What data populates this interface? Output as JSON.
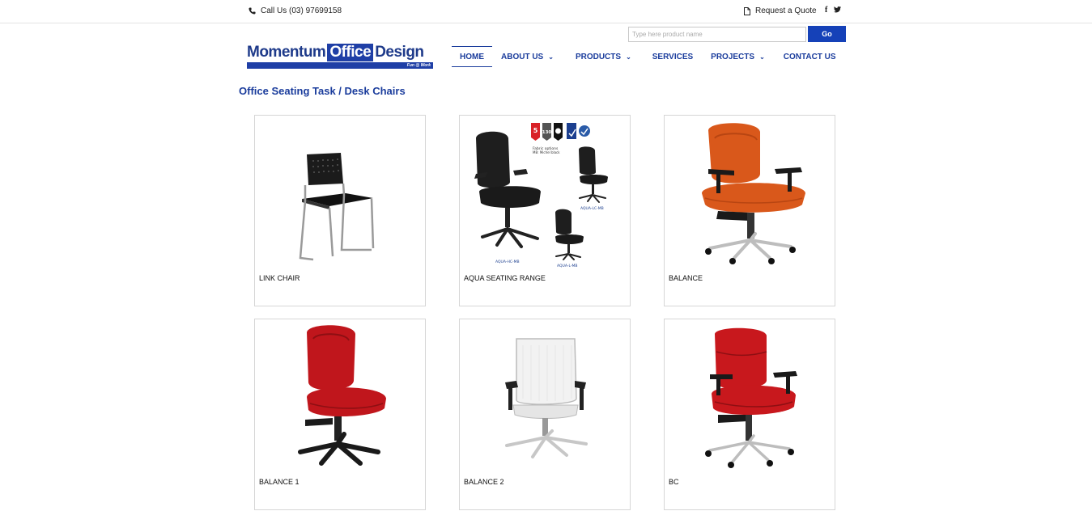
{
  "topbar": {
    "phone": "Call Us (03) 97699158",
    "quote": "Request a Quote",
    "social": [
      "f",
      "t"
    ]
  },
  "search": {
    "placeholder": "Type here product name",
    "button": "Go"
  },
  "logo": {
    "momentum": "Momentum",
    "office": "Office",
    "design": "Design",
    "tagline": "Fun @ Work"
  },
  "nav": {
    "items": [
      {
        "label": "HOME"
      },
      {
        "label": "ABOUT US"
      },
      {
        "label": "PRODUCTS"
      },
      {
        "label": "SERVICES"
      },
      {
        "label": "PROJECTS"
      },
      {
        "label": "CONTACT US"
      }
    ]
  },
  "page": {
    "title": "Office Seating Task / Desk Chairs"
  },
  "products": [
    {
      "name": "LINK CHAIR",
      "color": "#1b1b1b"
    },
    {
      "name": "AQUA SEATING RANGE",
      "color": "#1b1b1b"
    },
    {
      "name": "BALANCE",
      "color": "#d9581b"
    },
    {
      "name": "BALANCE 1",
      "color": "#c0161c"
    },
    {
      "name": "BALANCE 2",
      "color": "#f2f2f2"
    },
    {
      "name": "BC",
      "color": "#c8181d"
    }
  ],
  "aqua": {
    "badges": [
      "5",
      "130",
      "",
      "",
      ""
    ],
    "caption_top": "Fabric options",
    "caption_sub": "MB: Michel black",
    "models": [
      "AQUA-HC-MB",
      "AQUA-LC-MB",
      "AQUA-L-MB"
    ]
  },
  "colors": {
    "brand_blue": "#1a3c9c",
    "button_blue": "#1541b8"
  }
}
